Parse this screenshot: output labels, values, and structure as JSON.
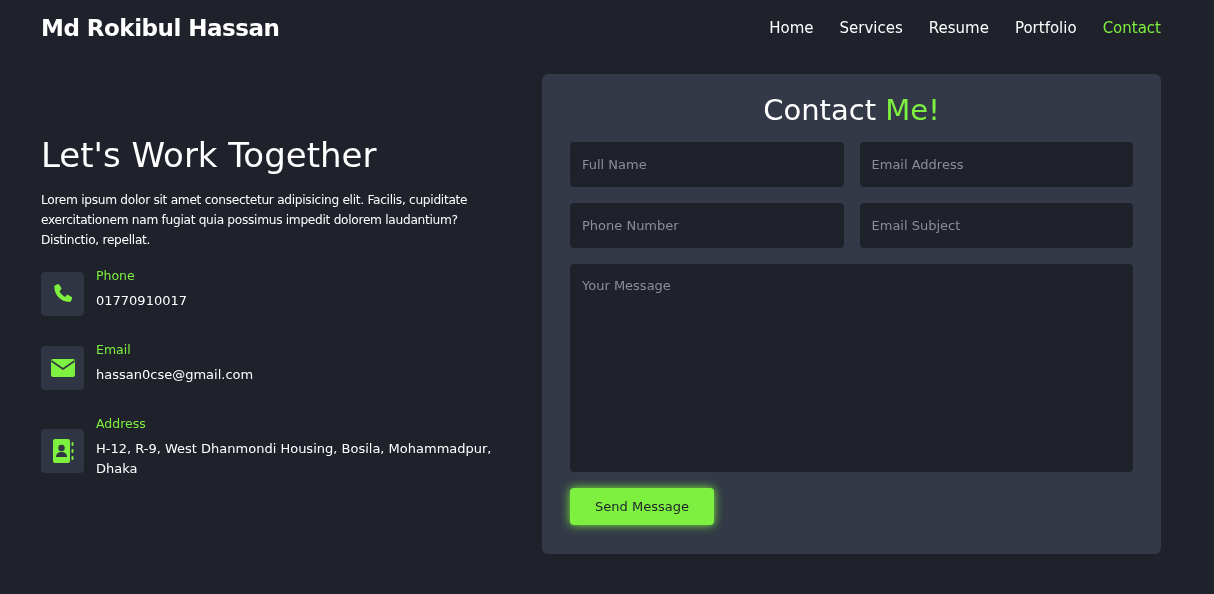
{
  "header": {
    "brand": "Md Rokibul Hassan",
    "nav": [
      {
        "label": "Home",
        "selected": false
      },
      {
        "label": "Services",
        "selected": false
      },
      {
        "label": "Resume",
        "selected": false
      },
      {
        "label": "Portfolio",
        "selected": false
      },
      {
        "label": "Contact",
        "selected": true
      }
    ]
  },
  "intro": {
    "heading": "Let's Work Together",
    "text": "Lorem ipsum dolor sit amet consectetur adipisicing elit. Facilis, cupiditate exercitationem nam fugiat quia possimus impedit dolorem laudantium? Distinctio, repellat.",
    "contacts": [
      {
        "kind": "phone",
        "label": "Phone",
        "value": "01770910017"
      },
      {
        "kind": "email",
        "label": "Email",
        "value": "hassan0cse@gmail.com"
      },
      {
        "kind": "address",
        "label": "Address",
        "value": "H-12, R-9, West Dhanmondi Housing, Bosila, Mohammadpur, Dhaka"
      }
    ]
  },
  "form": {
    "title": "Contact",
    "title_accent": "Me!",
    "fields": [
      {
        "placeholder": "Full Name"
      },
      {
        "placeholder": "Email Address"
      },
      {
        "placeholder": "Phone Number"
      },
      {
        "placeholder": "Email Subject"
      }
    ],
    "message": {
      "placeholder": "Your Message"
    },
    "button": "Send Message"
  }
}
